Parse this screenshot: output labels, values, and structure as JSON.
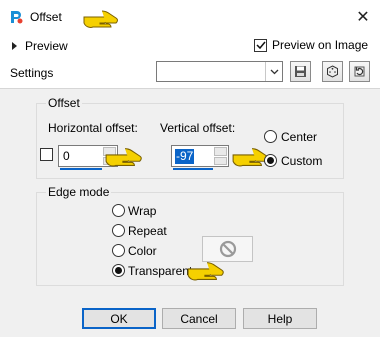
{
  "window": {
    "title": "Offset",
    "icons": {
      "app": "paint-shop-app-icon",
      "close": "close-icon",
      "pointer": "pointing-hand-icon"
    }
  },
  "preview": {
    "toggle_label": "Preview",
    "on_image_label": "Preview on Image",
    "on_image_checked": true
  },
  "settings": {
    "label": "Settings",
    "selected_value": ""
  },
  "offset": {
    "group_label": "Offset",
    "horizontal_label": "Horizontal offset:",
    "horizontal_value": "0",
    "vertical_label": "Vertical offset:",
    "vertical_value": "-97",
    "center_label": "Center",
    "custom_label": "Custom",
    "mode": "Custom",
    "checkbox_checked": false
  },
  "edge_mode": {
    "group_label": "Edge mode",
    "options": [
      "Wrap",
      "Repeat",
      "Color",
      "Transparent"
    ],
    "selected": "Transparent",
    "color_disabled_icon": "no-symbol-icon"
  },
  "buttons": {
    "ok": "OK",
    "cancel": "Cancel",
    "help": "Help"
  },
  "colors": {
    "accent": "#0a64c8",
    "panel": "#f0f0f0",
    "hand": "#f5d000"
  }
}
